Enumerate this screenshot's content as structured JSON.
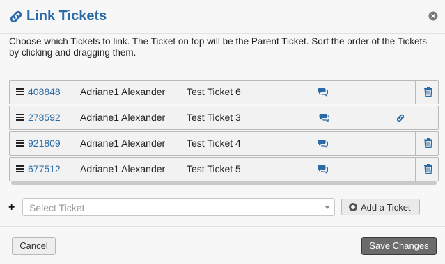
{
  "dialog": {
    "title": "Link Tickets",
    "description": "Choose which Tickets to link. The Ticket on top will be the Parent Ticket. Sort the order of the Tickets by clicking and dragging them."
  },
  "tickets": [
    {
      "id": "408848",
      "name": "Adriane1 Alexander",
      "subject": "Test Ticket 6",
      "action_icon": "trash-icon"
    },
    {
      "id": "278592",
      "name": "Adriane1 Alexander",
      "subject": "Test Ticket 3",
      "action_icon": "link-icon"
    },
    {
      "id": "921809",
      "name": "Adriane1 Alexander",
      "subject": "Test Ticket 4",
      "action_icon": "trash-icon"
    },
    {
      "id": "677512",
      "name": "Adriane1 Alexander",
      "subject": "Test Ticket 5",
      "action_icon": "trash-icon"
    }
  ],
  "add": {
    "select_placeholder": "Select Ticket",
    "add_label": "Add a Ticket"
  },
  "footer": {
    "cancel_label": "Cancel",
    "save_label": "Save Changes"
  },
  "colors": {
    "accent": "#2a6aa7",
    "save_button": "#6b6b6b"
  }
}
